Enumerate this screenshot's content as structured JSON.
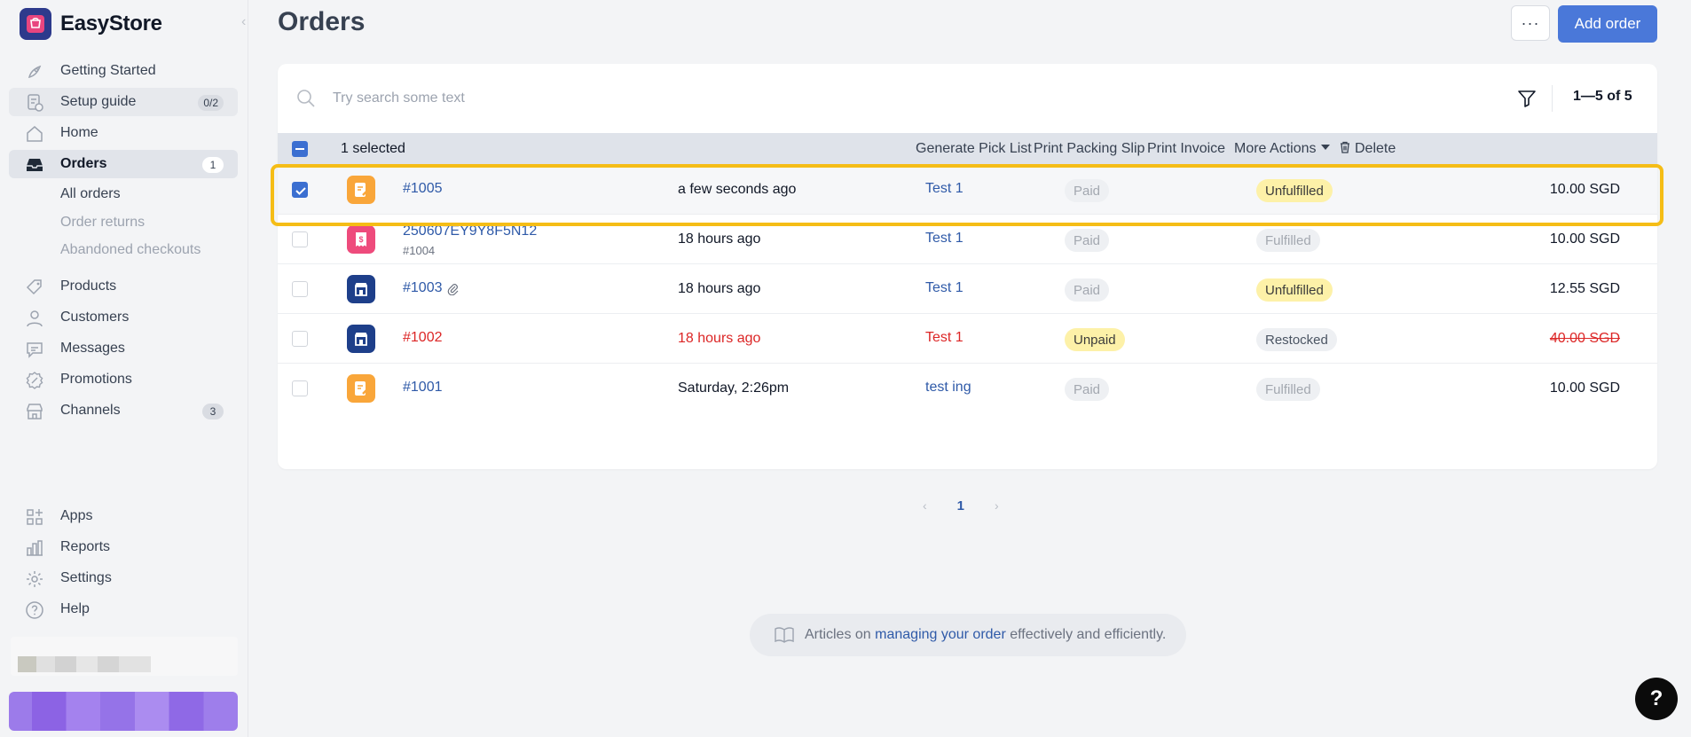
{
  "app": {
    "name": "EasyStore"
  },
  "sidebar": {
    "items": [
      {
        "label": "Getting Started",
        "icon": "rocket-icon"
      },
      {
        "label": "Setup guide",
        "icon": "checklist-icon",
        "badge": "0/2"
      },
      {
        "label": "Home",
        "icon": "home-icon"
      },
      {
        "label": "Orders",
        "icon": "inbox-icon",
        "badge": "1"
      },
      {
        "label": "Products",
        "icon": "tag-icon"
      },
      {
        "label": "Customers",
        "icon": "user-icon"
      },
      {
        "label": "Messages",
        "icon": "chat-icon"
      },
      {
        "label": "Promotions",
        "icon": "discount-icon"
      },
      {
        "label": "Channels",
        "icon": "store-icon",
        "badge": "3"
      }
    ],
    "orders_sub": [
      "All orders",
      "Order returns",
      "Abandoned checkouts"
    ],
    "bottom": [
      {
        "label": "Apps",
        "icon": "apps-icon"
      },
      {
        "label": "Reports",
        "icon": "bar-chart-icon"
      },
      {
        "label": "Settings",
        "icon": "gear-icon"
      },
      {
        "label": "Help",
        "icon": "help-icon"
      }
    ]
  },
  "header": {
    "title": "Orders",
    "more_label": "···",
    "add_label": "Add order"
  },
  "search": {
    "placeholder": "Try search some text"
  },
  "pagination_summary": "1—5 of 5",
  "bulk": {
    "selected": "1 selected",
    "actions": [
      "Generate Pick List",
      "Print Packing Slip",
      "Print Invoice",
      "More Actions"
    ],
    "delete": "Delete"
  },
  "orders": [
    {
      "id": "#1005",
      "sub": "",
      "date": "a few seconds ago",
      "customer": "Test 1",
      "payment": "Paid",
      "fulfillment": "Unfulfilled",
      "amount": "10.00 SGD",
      "channel": "draft-order-icon",
      "checked": true
    },
    {
      "id": "250607EY9Y8F5N12",
      "sub": "#1004",
      "date": "18 hours ago",
      "customer": "Test 1",
      "payment": "Paid",
      "fulfillment": "Fulfilled",
      "amount": "10.00 SGD",
      "channel": "pos-receipt-icon",
      "checked": false
    },
    {
      "id": "#1003",
      "sub": "",
      "date": "18 hours ago",
      "customer": "Test 1",
      "payment": "Paid",
      "fulfillment": "Unfulfilled",
      "amount": "12.55 SGD",
      "channel": "online-store-icon",
      "checked": false,
      "attachment": true
    },
    {
      "id": "#1002",
      "sub": "",
      "date": "18 hours ago",
      "customer": "Test 1",
      "payment": "Unpaid",
      "fulfillment": "Restocked",
      "amount": "40.00 SGD",
      "channel": "online-store-icon",
      "checked": false,
      "cancelled": true
    },
    {
      "id": "#1001",
      "sub": "",
      "date": "Saturday, 2:26pm",
      "customer": "test ing",
      "payment": "Paid",
      "fulfillment": "Fulfilled",
      "amount": "10.00 SGD",
      "channel": "draft-order-icon",
      "checked": false
    }
  ],
  "pager": {
    "current": "1"
  },
  "articles": {
    "prefix": "Articles on ",
    "link": "managing your order",
    "suffix": " effectively and efficiently."
  },
  "help_fab": "?",
  "colors": {
    "primary": "#4a78d9",
    "highlight": "#f5bd16",
    "link": "#2f5aa8",
    "danger": "#dc2626"
  }
}
